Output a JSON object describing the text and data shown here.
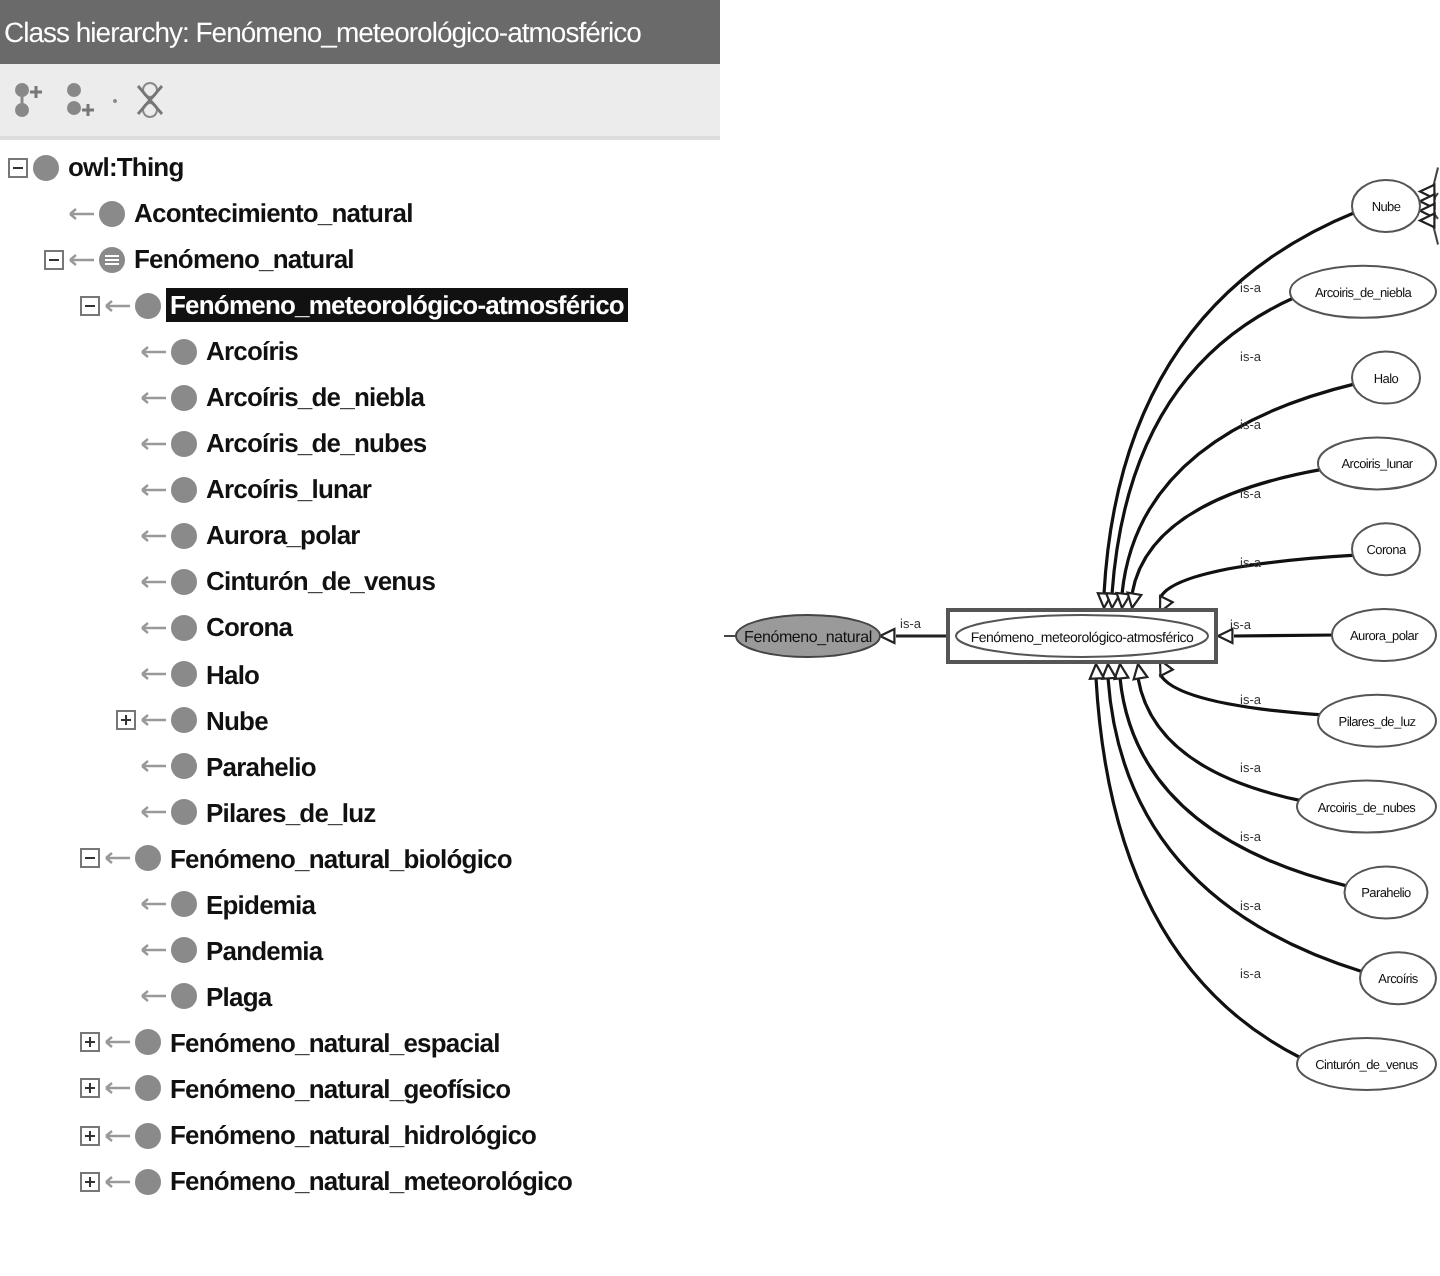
{
  "panel": {
    "title": "Class hierarchy: Fenómeno_meteorológico-atmosférico"
  },
  "tree": [
    {
      "label": "owl:Thing",
      "kind": "class",
      "selected": false,
      "expanded": true,
      "children": [
        {
          "label": "Acontecimiento_natural",
          "kind": "class",
          "selected": false
        },
        {
          "label": "Fenómeno_natural",
          "kind": "defined",
          "selected": false,
          "expanded": true,
          "children": [
            {
              "label": "Fenómeno_meteorológico-atmosférico",
              "kind": "class",
              "selected": true,
              "expanded": true,
              "children": [
                {
                  "label": "Arcoíris",
                  "kind": "class",
                  "selected": false
                },
                {
                  "label": "Arcoíris_de_niebla",
                  "kind": "class",
                  "selected": false
                },
                {
                  "label": "Arcoíris_de_nubes",
                  "kind": "class",
                  "selected": false
                },
                {
                  "label": "Arcoíris_lunar",
                  "kind": "class",
                  "selected": false
                },
                {
                  "label": "Aurora_polar",
                  "kind": "class",
                  "selected": false
                },
                {
                  "label": "Cinturón_de_venus",
                  "kind": "class",
                  "selected": false
                },
                {
                  "label": "Corona",
                  "kind": "class",
                  "selected": false
                },
                {
                  "label": "Halo",
                  "kind": "class",
                  "selected": false
                },
                {
                  "label": "Nube",
                  "kind": "class",
                  "selected": false,
                  "expanded": false
                },
                {
                  "label": "Parahelio",
                  "kind": "class",
                  "selected": false
                },
                {
                  "label": "Pilares_de_luz",
                  "kind": "class",
                  "selected": false
                }
              ]
            },
            {
              "label": "Fenómeno_natural_biológico",
              "kind": "class",
              "selected": false,
              "expanded": true,
              "children": [
                {
                  "label": "Epidemia",
                  "kind": "class",
                  "selected": false
                },
                {
                  "label": "Pandemia",
                  "kind": "class",
                  "selected": false
                },
                {
                  "label": "Plaga",
                  "kind": "class",
                  "selected": false
                }
              ]
            },
            {
              "label": "Fenómeno_natural_espacial",
              "kind": "class",
              "selected": false,
              "expanded": false
            },
            {
              "label": "Fenómeno_natural_geofísico",
              "kind": "class",
              "selected": false,
              "expanded": false
            },
            {
              "label": "Fenómeno_natural_hidrológico",
              "kind": "class",
              "selected": false,
              "expanded": false
            },
            {
              "label": "Fenómeno_natural_meteorológico",
              "kind": "class",
              "selected": false,
              "expanded": false
            }
          ]
        }
      ]
    }
  ],
  "graph": {
    "focus": {
      "label": "Fenómeno_meteorológico-atmosférico"
    },
    "parent": {
      "label": "Fenómeno_natural",
      "edge_label": "is-a"
    },
    "children": [
      {
        "label": "Nube",
        "edge_label": "is-a",
        "has_subclasses": true
      },
      {
        "label": "Arcoiris_de_niebla",
        "edge_label": "is-a",
        "has_subclasses": false
      },
      {
        "label": "Halo",
        "edge_label": "is-a",
        "has_subclasses": false
      },
      {
        "label": "Arcoiris_lunar",
        "edge_label": "is-a",
        "has_subclasses": false
      },
      {
        "label": "Corona",
        "edge_label": "is-a",
        "has_subclasses": false
      },
      {
        "label": "Aurora_polar",
        "edge_label": "is-a",
        "has_subclasses": false
      },
      {
        "label": "Pilares_de_luz",
        "edge_label": "is-a",
        "has_subclasses": false
      },
      {
        "label": "Arcoiris_de_nubes",
        "edge_label": "is-a",
        "has_subclasses": false
      },
      {
        "label": "Parahelio",
        "edge_label": "is-a",
        "has_subclasses": false
      },
      {
        "label": "Arcoíris",
        "edge_label": "is-a",
        "has_subclasses": false
      },
      {
        "label": "Cinturón_de_venus",
        "edge_label": "is-a",
        "has_subclasses": false
      }
    ]
  }
}
